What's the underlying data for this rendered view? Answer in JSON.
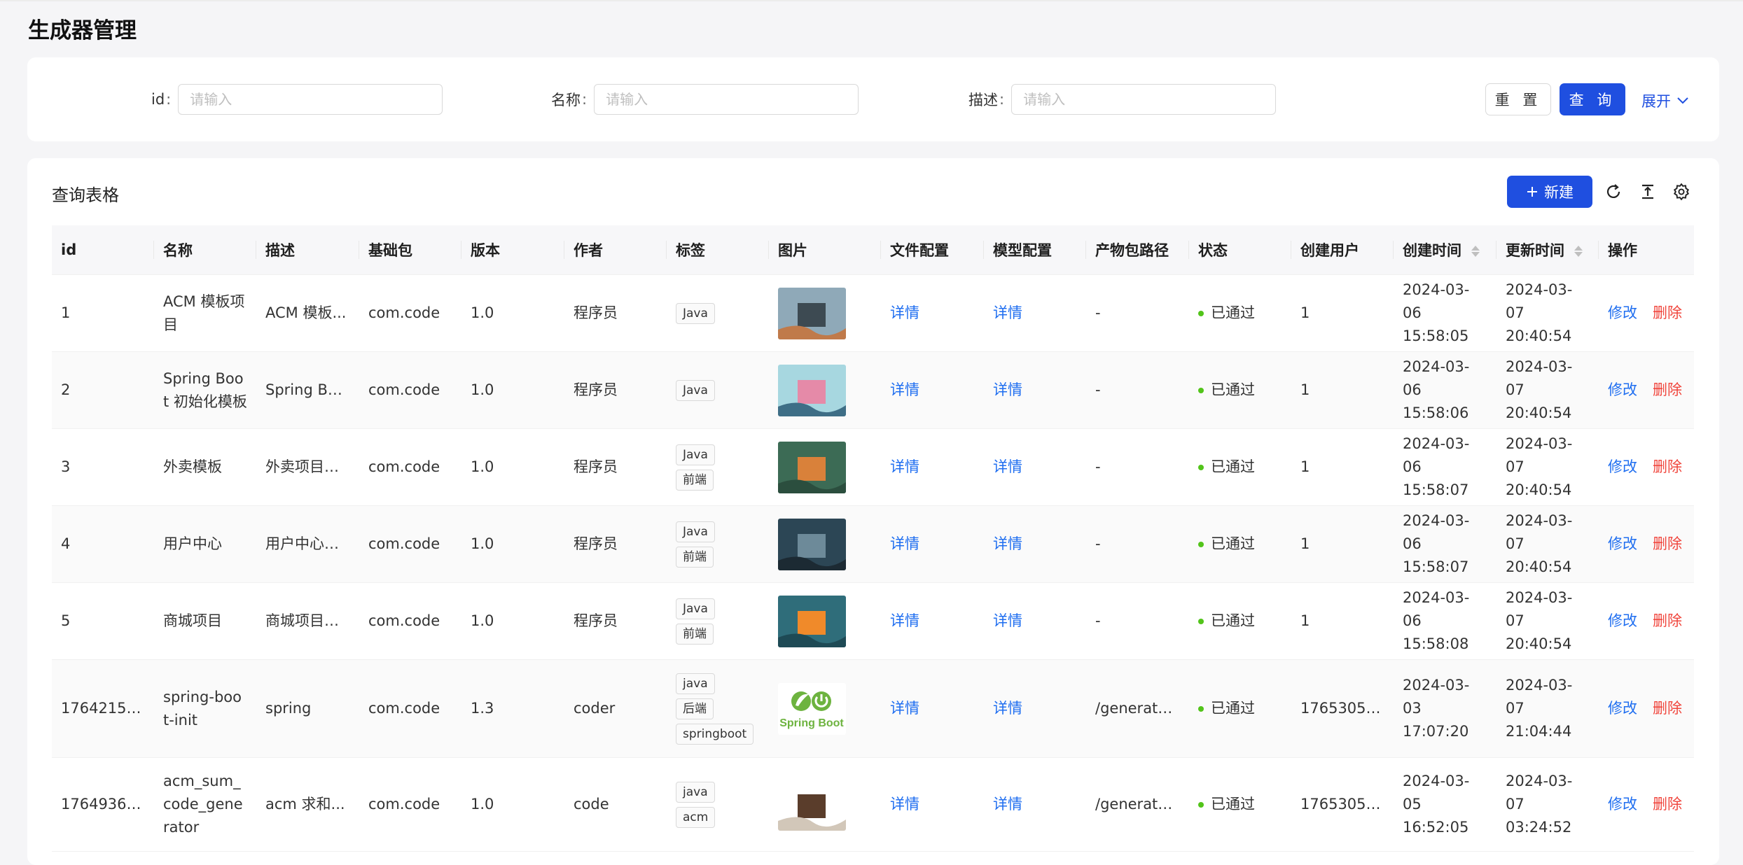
{
  "page": {
    "title": "生成器管理"
  },
  "search": {
    "fields": [
      {
        "label": "id",
        "placeholder": "请输入",
        "value": ""
      },
      {
        "label": "名称",
        "placeholder": "请输入",
        "value": ""
      },
      {
        "label": "描述",
        "placeholder": "请输入",
        "value": ""
      }
    ],
    "reset_label": "重 置",
    "query_label": "查 询",
    "expand_label": "展开"
  },
  "table_card": {
    "title": "查询表格",
    "new_label": "新建",
    "toolbar_icons": [
      "reload-icon",
      "density-icon",
      "settings-icon"
    ]
  },
  "columns": [
    "id",
    "名称",
    "描述",
    "基础包",
    "版本",
    "作者",
    "标签",
    "图片",
    "文件配置",
    "模型配置",
    "产物包路径",
    "状态",
    "创建用户",
    "创建时间",
    "更新时间",
    "操作"
  ],
  "rows": [
    {
      "id": "1",
      "name": "ACM 模板项目",
      "desc": "ACM 模板...",
      "base_package": "com.code",
      "version": "1.0",
      "author": "程序员",
      "tags": [
        "Java"
      ],
      "image": "scene-landscape",
      "file_config": "详情",
      "model_config": "详情",
      "dist_path": "-",
      "status": "已通过",
      "user": "1",
      "created_date": "2024-03-06",
      "created_time": "15:58:05",
      "updated_date": "2024-03-07",
      "updated_time": "20:40:54",
      "edit": "修改",
      "delete": "删除"
    },
    {
      "id": "2",
      "name": "Spring Boot 初始化模板",
      "desc": "Spring Boo...",
      "base_package": "com.code",
      "version": "1.0",
      "author": "程序员",
      "tags": [
        "Java"
      ],
      "image": "pink-gift-box",
      "file_config": "详情",
      "model_config": "详情",
      "dist_path": "-",
      "status": "已通过",
      "user": "1",
      "created_date": "2024-03-06",
      "created_time": "15:58:06",
      "updated_date": "2024-03-07",
      "updated_time": "20:40:54",
      "edit": "修改",
      "delete": "删除"
    },
    {
      "id": "3",
      "name": "外卖模板",
      "desc": "外卖项目生...",
      "base_package": "com.code",
      "version": "1.0",
      "author": "程序员",
      "tags": [
        "Java",
        "前端"
      ],
      "image": "fantasy-island",
      "file_config": "详情",
      "model_config": "详情",
      "dist_path": "-",
      "status": "已通过",
      "user": "1",
      "created_date": "2024-03-06",
      "created_time": "15:58:07",
      "updated_date": "2024-03-07",
      "updated_time": "20:40:54",
      "edit": "修改",
      "delete": "删除"
    },
    {
      "id": "4",
      "name": "用户中心",
      "desc": "用户中心项...",
      "base_package": "com.code",
      "version": "1.0",
      "author": "程序员",
      "tags": [
        "Java",
        "前端"
      ],
      "image": "dark-treasure-chest",
      "file_config": "详情",
      "model_config": "详情",
      "dist_path": "-",
      "status": "已通过",
      "user": "1",
      "created_date": "2024-03-06",
      "created_time": "15:58:07",
      "updated_date": "2024-03-07",
      "updated_time": "20:40:54",
      "edit": "修改",
      "delete": "删除"
    },
    {
      "id": "5",
      "name": "商城项目",
      "desc": "商城项目生...",
      "base_package": "com.code",
      "version": "1.0",
      "author": "程序员",
      "tags": [
        "Java",
        "前端"
      ],
      "image": "orange-treasure-chest",
      "file_config": "详情",
      "model_config": "详情",
      "dist_path": "-",
      "status": "已通过",
      "user": "1",
      "created_date": "2024-03-06",
      "created_time": "15:58:08",
      "updated_date": "2024-03-07",
      "updated_time": "20:40:54",
      "edit": "修改",
      "delete": "删除"
    },
    {
      "id": "176421597...",
      "name": "spring-boot-init",
      "desc": "spring",
      "base_package": "com.code",
      "version": "1.3",
      "author": "coder",
      "tags": [
        "java",
        "后端",
        "springboot"
      ],
      "image": "spring-boot-logo",
      "image_text": "Spring Boot",
      "file_config": "详情",
      "model_config": "详情",
      "dist_path": "/generator...",
      "status": "已通过",
      "user": "176530580...",
      "created_date": "2024-03-03",
      "created_time": "17:07:20",
      "updated_date": "2024-03-07",
      "updated_time": "21:04:44",
      "edit": "修改",
      "delete": "删除"
    },
    {
      "id": "176493691...",
      "name": "acm_sum_code_generator",
      "desc": "acm 求和...",
      "base_package": "com.code",
      "version": "1.0",
      "author": "code",
      "tags": [
        "java",
        "acm"
      ],
      "image": "wooden-house",
      "file_config": "详情",
      "model_config": "详情",
      "dist_path": "/generator...",
      "status": "已通过",
      "user": "176530580...",
      "created_date": "2024-03-05",
      "created_time": "16:52:05",
      "updated_date": "2024-03-07",
      "updated_time": "03:24:52",
      "edit": "修改",
      "delete": "删除"
    }
  ],
  "colors": {
    "primary": "#1f4fe0",
    "link": "#1f6ef0",
    "danger": "#f0453c",
    "success": "#52c41a"
  }
}
